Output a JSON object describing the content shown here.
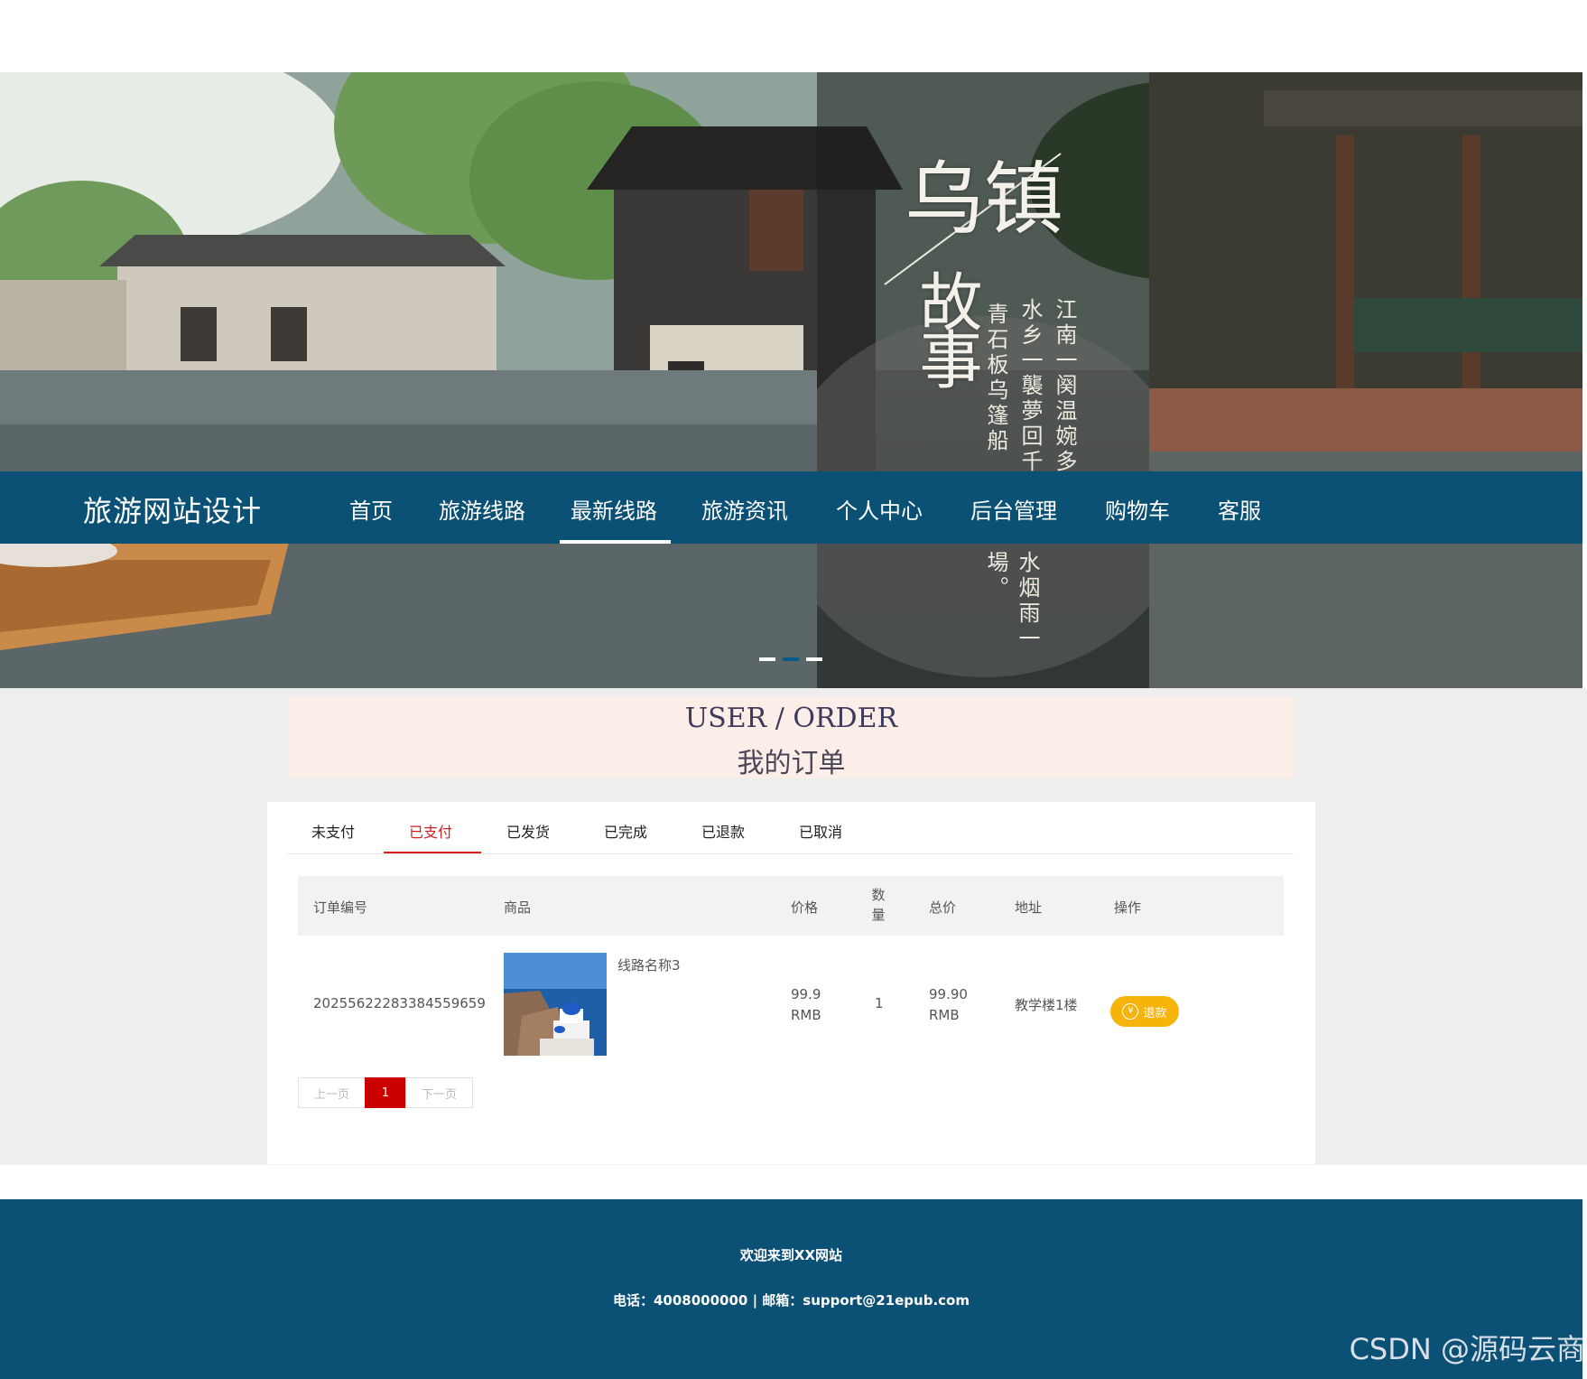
{
  "banner": {
    "title_line1": "乌镇",
    "title_line2": "故事",
    "poem_cols": [
      "江南一阕温婉多",
      "水乡一襲夢回千",
      "青石板乌篷船"
    ],
    "lower_poem": "水烟雨一場。",
    "active_slide": 2,
    "slide_count": 3
  },
  "nav": {
    "brand": "旅游网站设计",
    "items": [
      "首页",
      "旅游线路",
      "最新线路",
      "旅游资讯",
      "个人中心",
      "后台管理",
      "购物车",
      "客服"
    ],
    "active": "最新线路"
  },
  "page_title": {
    "en": "USER / ORDER",
    "cn": "我的订单"
  },
  "tabs": {
    "items": [
      "未支付",
      "已支付",
      "已发货",
      "已完成",
      "已退款",
      "已取消"
    ],
    "active": "已支付"
  },
  "table": {
    "headers": {
      "order_no": "订单编号",
      "product": "商品",
      "price": "价格",
      "qty_top": "数",
      "qty_bottom": "量",
      "total": "总价",
      "address": "地址",
      "action": "操作"
    },
    "rows": [
      {
        "order_no": "20255622283384559659",
        "product_name": "线路名称3",
        "price_value": "99.9",
        "price_unit": "RMB",
        "qty": "1",
        "total_value": "99.90",
        "total_unit": "RMB",
        "address": "教学楼1楼",
        "action_label": "退款",
        "action_icon": "yen-coin-icon"
      }
    ]
  },
  "pager": {
    "prev": "上一页",
    "current": "1",
    "next": "下一页"
  },
  "footer": {
    "welcome": "欢迎来到XX网站",
    "contact": "电话：4008000000 | 邮箱：support@21epub.com"
  },
  "watermark": "CSDN @源码云商",
  "colors": {
    "nav_bg": "#0b5075",
    "active_tab": "#d21f1f",
    "refund_button": "#f6b40a",
    "pager_current": "#cc0000"
  }
}
